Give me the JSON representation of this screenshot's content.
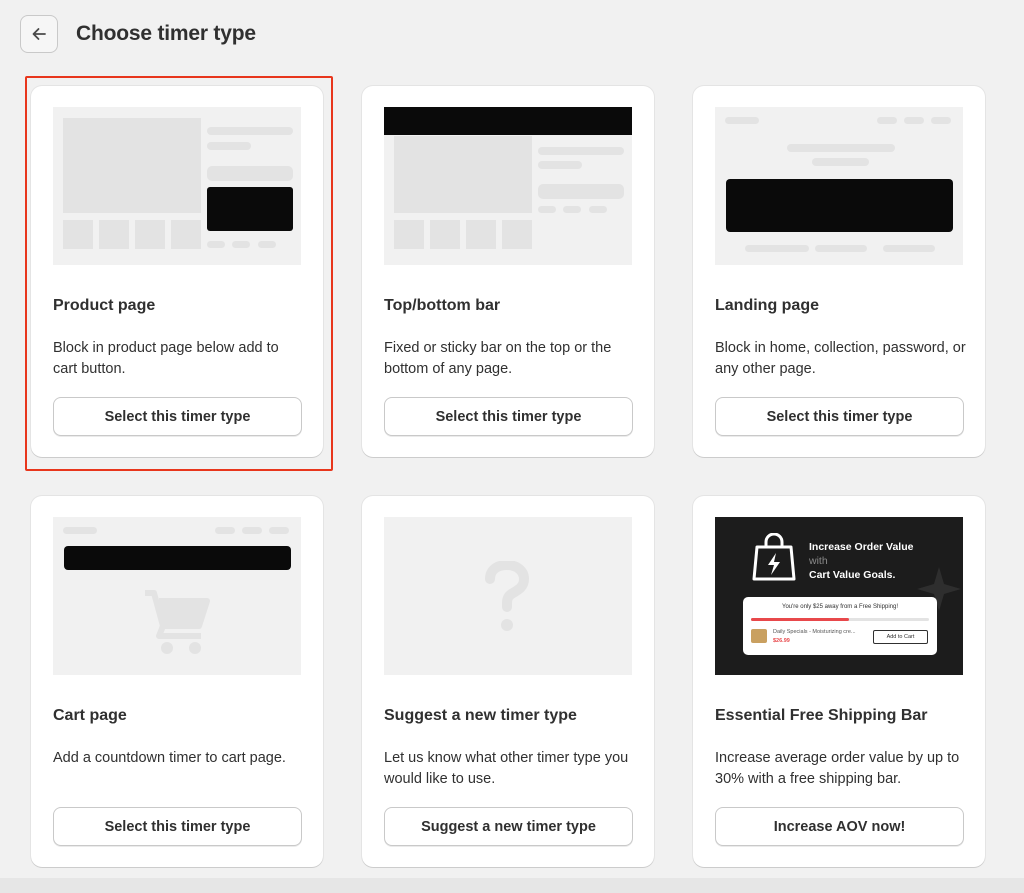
{
  "header": {
    "title": "Choose timer type",
    "back_icon": "arrow-left-icon"
  },
  "cards": [
    {
      "title": "Product page",
      "description": "Block in product page below add to cart button.",
      "button": "Select this timer type",
      "selected": true
    },
    {
      "title": "Top/bottom bar",
      "description": "Fixed or sticky bar on the top or the bottom of any page.",
      "button": "Select this timer type"
    },
    {
      "title": "Landing page",
      "description": "Block in home, collection, password, or any other page.",
      "button": "Select this timer type"
    },
    {
      "title": "Cart page",
      "description": "Add a countdown timer to cart page.",
      "button": "Select this timer type",
      "icon": "shopping-cart-icon"
    },
    {
      "title": "Suggest a new timer type",
      "description": "Let us know what other timer type you would like to use.",
      "button": "Suggest a new timer type",
      "icon": "question-mark-icon"
    },
    {
      "title": "Essential Free Shipping Bar",
      "description": "Increase average order value by up to 30% with a free shipping bar.",
      "button": "Increase AOV now!",
      "promo": {
        "headline_1": "Increase Order Value",
        "headline_2": "with",
        "headline_3": "Cart Value Goals.",
        "bar_text": "You're only $25 away from a Free Shipping!",
        "progress": 0.55,
        "product_name": "Daily Specials - Moisturizing cre...",
        "product_price": "$26.99",
        "add_button": "Add to Cart"
      }
    }
  ],
  "colors": {
    "background": "#f1f1f1",
    "card": "#ffffff",
    "selected_outline": "#e8361c",
    "dark_block": "#0a0a0a",
    "placeholder_block": "#e3e3e3",
    "progress_fill": "#e8484b"
  }
}
